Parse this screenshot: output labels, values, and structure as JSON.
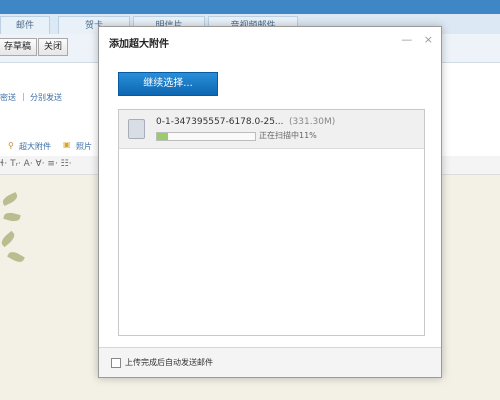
{
  "bg": {
    "tabs": [
      "邮件",
      "贺卡",
      "明信片",
      "音视频邮件"
    ],
    "toolbar": {
      "save_draft": "存草稿",
      "close": "关闭"
    },
    "links": {
      "secret_send": "密送",
      "separate_send": "分别发送"
    },
    "attach": {
      "large": "超大附件",
      "photo": "照片"
    },
    "format_glyphs": "ɬ· Tᵣ· A· Ɐ· ≡· ☷·"
  },
  "dialog": {
    "title": "添加超大附件",
    "controls": {
      "minimize": "—",
      "close": "×"
    },
    "continue_button": "继续选择...",
    "file": {
      "name": "0-1-347395557-6178.0-25...",
      "size": "(331.30M)",
      "status": "正在扫描中11%",
      "progress_fraction": 0.11
    },
    "auto_send_label": "上传完成后自动发送邮件",
    "auto_send_checked": false
  }
}
